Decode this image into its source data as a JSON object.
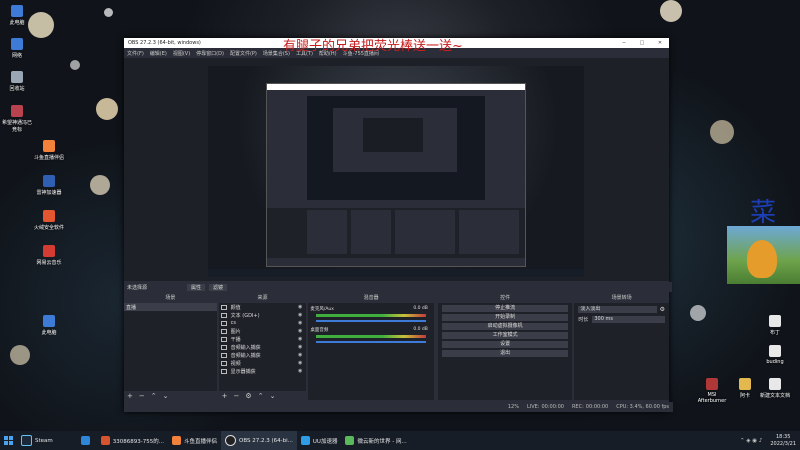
{
  "overlay": {
    "main_text": "有腿子的兄弟把荧光棒送一送~",
    "side_char": "菜"
  },
  "obs": {
    "title": "OBS 27.2.3 (64-bit, windows)",
    "menu": [
      "文件(F)",
      "编辑(E)",
      "视图(V)",
      "停靠窗口(D)",
      "配置文件(P)",
      "场景集合(S)",
      "工具(T)",
      "帮助(H)",
      "斗鱼-755直播间"
    ],
    "status_line": "未选择源",
    "properties_label": "属性",
    "filters_label": "滤镜",
    "docks": {
      "scenes": {
        "title": "场景",
        "items": [
          "直播"
        ]
      },
      "sources": {
        "title": "来源",
        "items": [
          "颜值",
          "文本 (GDI+)",
          "cs",
          "图片",
          "干播",
          "音频输入捕获",
          "音频输入捕获",
          "视频",
          "显示器捕获",
          "窗口采集"
        ]
      },
      "mixer": {
        "title": "混音器",
        "channels": [
          {
            "name": "麦克风/Aux",
            "db": "0.0 dB"
          },
          {
            "name": "桌面音频",
            "db": "0.0 dB"
          }
        ]
      },
      "transitions_title": "转场",
      "controls": {
        "title": "控件",
        "buttons": [
          "停止推流",
          "开始录制",
          "启动虚拟摄像机",
          "工作室模式",
          "设置",
          "退出"
        ]
      },
      "scene_transition": {
        "title": "场景转场",
        "selected": "淡入淡出",
        "duration_label": "时长",
        "duration_value": "300 ms"
      }
    },
    "bottom_status": {
      "dropped": "12%",
      "live_label": "LIVE:",
      "live_time": "00:00:00",
      "rec_label": "REC:",
      "rec_time": "00:00:00",
      "cpu": "CPU: 3.4%, 60.00 fps"
    }
  },
  "desktop_icons": [
    "此电脑",
    "网络",
    "回收站",
    "希望神通冯已竞标",
    "斗鱼直播伴侣",
    "雷神加速器",
    "火绒安全软件",
    "网易云音乐",
    "此电脑",
    "MSI Afterburner",
    "布丁",
    "buding",
    "新建文本文档",
    "阿卡"
  ],
  "taskbar": {
    "items": [
      "Steam",
      "33086893-755的...",
      "斗鱼直播伴侣",
      "OBS 27.2.3 (64-bi...",
      "UU加速器",
      "微云新的世界 - 网..."
    ],
    "time": "18:35",
    "date": "2022/3/21"
  },
  "colors": {
    "overlay_red": "#c81e1e",
    "obs_bg": "#2b2e38",
    "taskbar": "#161d27"
  }
}
